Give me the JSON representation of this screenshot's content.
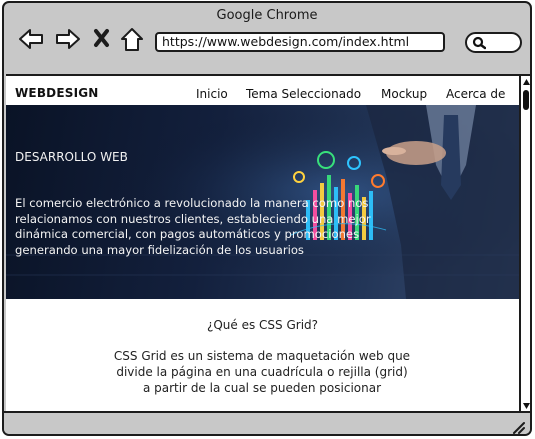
{
  "window": {
    "title": "Google Chrome"
  },
  "toolbar": {
    "back_icon": "arrow-left-icon",
    "forward_icon": "arrow-right-icon",
    "stop_icon": "close-icon",
    "home_icon": "home-icon",
    "url": "https://www.webdesign.com/index.html",
    "search_icon": "search-icon"
  },
  "site": {
    "brand": "WEBDESIGN",
    "nav": [
      {
        "label": "Inicio"
      },
      {
        "label": "Tema Seleccionado"
      },
      {
        "label": "Mockup"
      },
      {
        "label": "Acerca de"
      }
    ]
  },
  "hero": {
    "kicker": "DESARROLLO WEB",
    "text": "El comercio electrónico a revolucionado la manera como nos relacionamos con nuestros clientes, estableciendo una mejor dinámica comercial, con pagos automáticos y promociones generando una mayor fidelización de los usuarios"
  },
  "article": {
    "title": "¿Qué es CSS Grid?",
    "body": "CSS Grid es un sistema de maquetación web que divide la página en una cuadrícula o rejilla (grid) a partir de la cual se pueden posicionar"
  },
  "colors": {
    "frame": "#1c1c1c",
    "chrome": "#c8c8c8",
    "hero_dark": "#0a1326"
  }
}
